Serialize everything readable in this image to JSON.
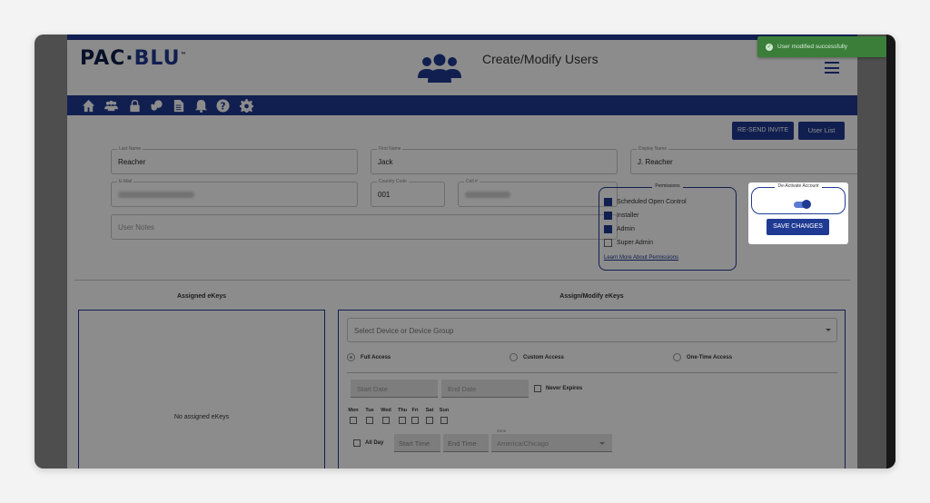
{
  "app": {
    "logo_left": "PAC·",
    "logo_right": "BLU",
    "logo_tm": "™",
    "title": "Create/Modify Users"
  },
  "nav": {
    "icons": [
      "home-icon",
      "users-icon",
      "lock-icon",
      "keys-icon",
      "document-icon",
      "bell-icon",
      "help-icon",
      "gear-icon"
    ]
  },
  "actions": {
    "resend_invite": "RE-SEND INVITE",
    "user_list": "User List",
    "save_changes": "SAVE CHANGES"
  },
  "form": {
    "last_name": {
      "label": "Last Name",
      "value": "Reacher"
    },
    "first_name": {
      "label": "First Name",
      "value": "Jack"
    },
    "display_name": {
      "label": "Display Name",
      "value": "J. Reacher"
    },
    "email": {
      "label": "E-Mail"
    },
    "country_code": {
      "label": "Country Code",
      "value": "001"
    },
    "cell": {
      "label": "Cell #"
    },
    "user_notes": {
      "placeholder": "User Notes"
    }
  },
  "permissions": {
    "title": "Permissions",
    "items": [
      {
        "label": "Scheduled Open Control",
        "checked": true
      },
      {
        "label": "Installer",
        "checked": true
      },
      {
        "label": "Admin",
        "checked": true
      },
      {
        "label": "Super Admin",
        "checked": false
      }
    ],
    "learn_more": "Learn More About Permissions"
  },
  "deactivate": {
    "title": "De-Activate Account",
    "toggle_on": true
  },
  "ekeys": {
    "assigned_title": "Assigned eKeys",
    "empty_text": "No assigned eKeys",
    "assign_title": "Assign/Modify eKeys",
    "device_placeholder": "Select Device or Device Group",
    "access_types": [
      "Full Access",
      "Custom Access",
      "One-Time Access"
    ],
    "selected_access": "Full Access",
    "start_date": "Start Date",
    "end_date": "End Date",
    "never_expires": "Never Expires",
    "days": [
      "Mon",
      "Tue",
      "Wed",
      "Thu",
      "Fri",
      "Sat",
      "Sun"
    ],
    "all_day": "All Day",
    "start_time": "Start Time",
    "end_time": "End Time",
    "zone_label": "Zone",
    "zone_value": "America/Chicago"
  },
  "toast": {
    "message": "User modified successfully",
    "color": "#3a7e3a"
  },
  "colors": {
    "brand": "#1f3a93",
    "overlay": "rgba(0,0,0,0.45)"
  }
}
